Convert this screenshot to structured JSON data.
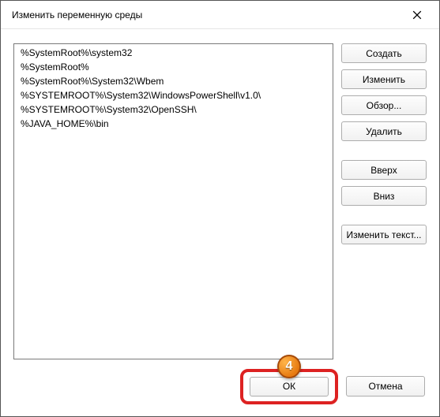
{
  "window": {
    "title": "Изменить переменную среды"
  },
  "path_entries": [
    "%SystemRoot%\\system32",
    "%SystemRoot%",
    "%SystemRoot%\\System32\\Wbem",
    "%SYSTEMROOT%\\System32\\WindowsPowerShell\\v1.0\\",
    "%SYSTEMROOT%\\System32\\OpenSSH\\",
    "%JAVA_HOME%\\bin"
  ],
  "buttons": {
    "create": "Создать",
    "edit": "Изменить",
    "browse": "Обзор...",
    "delete": "Удалить",
    "up": "Вверх",
    "down": "Вниз",
    "edit_text": "Изменить текст...",
    "ok": "ОК",
    "cancel": "Отмена"
  },
  "callout": {
    "number": "4"
  }
}
